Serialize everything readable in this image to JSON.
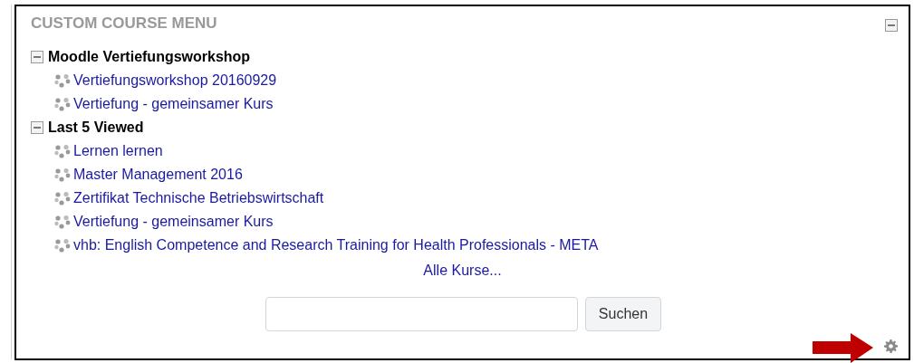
{
  "block": {
    "title": "CUSTOM COURSE MENU",
    "collapsed": false
  },
  "categories": [
    {
      "label": "Moodle Vertiefungsworkshop",
      "expanded": true,
      "children": [
        {
          "label": "Vertiefungsworkshop 20160929"
        },
        {
          "label": "Vertiefung - gemeinsamer Kurs"
        }
      ]
    },
    {
      "label": "Last 5 Viewed",
      "expanded": true,
      "children": [
        {
          "label": "Lernen lernen"
        },
        {
          "label": "Master Management 2016"
        },
        {
          "label": "Zertifikat Technische Betriebswirtschaft"
        },
        {
          "label": "Vertiefung - gemeinsamer Kurs"
        },
        {
          "label": "vhb: English Competence and Research Training for Health Professionals - META"
        }
      ]
    }
  ],
  "all_courses": "Alle Kurse...",
  "search": {
    "button": "Suchen"
  }
}
